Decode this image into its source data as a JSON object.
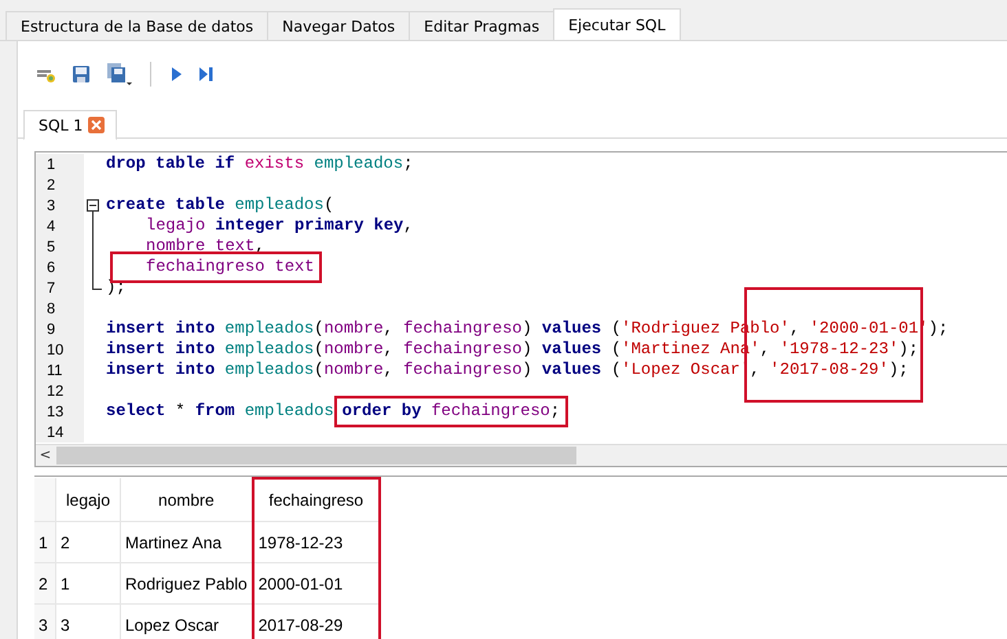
{
  "tabs": [
    {
      "label": "Estructura de la Base de datos",
      "selected": false
    },
    {
      "label": "Navegar Datos",
      "selected": false
    },
    {
      "label": "Editar Pragmas",
      "selected": false
    },
    {
      "label": "Ejecutar SQL",
      "selected": true
    }
  ],
  "editor_tab": {
    "label": "SQL 1"
  },
  "editor": {
    "values_box": true,
    "lines": [
      {
        "num": "1",
        "segments": [
          {
            "boxed": false,
            "tokens": [
              {
                "kind": "kw",
                "text": "drop table if "
              },
              {
                "kind": "fn",
                "text": "exists "
              },
              {
                "kind": "tbl",
                "text": "empleados"
              },
              {
                "kind": "p",
                "text": ";"
              }
            ]
          }
        ]
      },
      {
        "num": "2"
      },
      {
        "num": "3",
        "fold_start": true,
        "segments": [
          {
            "boxed": false,
            "tokens": [
              {
                "kind": "kw",
                "text": "create table "
              },
              {
                "kind": "tbl",
                "text": "empleados"
              },
              {
                "kind": "p",
                "text": "("
              }
            ]
          }
        ]
      },
      {
        "num": "4",
        "in_fold": true,
        "indented": true,
        "segments": [
          {
            "boxed": false,
            "tokens": [
              {
                "kind": "col",
                "text": "legajo "
              },
              {
                "kind": "kw",
                "text": "integer primary key"
              },
              {
                "kind": "p",
                "text": ","
              }
            ]
          }
        ]
      },
      {
        "num": "5",
        "in_fold": true,
        "indented": true,
        "segments": [
          {
            "boxed": false,
            "tokens": [
              {
                "kind": "col",
                "text": "nombre text"
              },
              {
                "kind": "p",
                "text": ","
              }
            ]
          }
        ]
      },
      {
        "num": "6",
        "in_fold": true,
        "indented": true,
        "segments": [
          {
            "boxed": true,
            "tokens": [
              {
                "kind": "col",
                "text": "fechaingreso text"
              }
            ]
          }
        ]
      },
      {
        "num": "7",
        "fold_end": true,
        "segments": [
          {
            "boxed": false,
            "tokens": [
              {
                "kind": "p",
                "text": ");"
              }
            ]
          }
        ]
      },
      {
        "num": "8"
      },
      {
        "num": "9",
        "segments": [
          {
            "boxed": false,
            "tokens": [
              {
                "kind": "kw",
                "text": "insert into "
              },
              {
                "kind": "tbl",
                "text": "empleados"
              },
              {
                "kind": "p",
                "text": "("
              },
              {
                "kind": "col",
                "text": "nombre"
              },
              {
                "kind": "p",
                "text": ", "
              },
              {
                "kind": "col",
                "text": "fechaingreso"
              },
              {
                "kind": "p",
                "text": ") "
              },
              {
                "kind": "kw",
                "text": "values "
              },
              {
                "kind": "p",
                "text": "("
              },
              {
                "kind": "str",
                "text": "'Rodriguez Pablo'"
              },
              {
                "kind": "p",
                "text": ", "
              },
              {
                "kind": "str",
                "text": "'2000-01-01'"
              },
              {
                "kind": "p",
                "text": ");"
              }
            ]
          }
        ]
      },
      {
        "num": "10",
        "segments": [
          {
            "boxed": false,
            "tokens": [
              {
                "kind": "kw",
                "text": "insert into "
              },
              {
                "kind": "tbl",
                "text": "empleados"
              },
              {
                "kind": "p",
                "text": "("
              },
              {
                "kind": "col",
                "text": "nombre"
              },
              {
                "kind": "p",
                "text": ", "
              },
              {
                "kind": "col",
                "text": "fechaingreso"
              },
              {
                "kind": "p",
                "text": ") "
              },
              {
                "kind": "kw",
                "text": "values "
              },
              {
                "kind": "p",
                "text": "("
              },
              {
                "kind": "str",
                "text": "'Martinez Ana'"
              },
              {
                "kind": "p",
                "text": ", "
              },
              {
                "kind": "str",
                "text": "'1978-12-23'"
              },
              {
                "kind": "p",
                "text": ");"
              }
            ]
          }
        ]
      },
      {
        "num": "11",
        "segments": [
          {
            "boxed": false,
            "tokens": [
              {
                "kind": "kw",
                "text": "insert into "
              },
              {
                "kind": "tbl",
                "text": "empleados"
              },
              {
                "kind": "p",
                "text": "("
              },
              {
                "kind": "col",
                "text": "nombre"
              },
              {
                "kind": "p",
                "text": ", "
              },
              {
                "kind": "col",
                "text": "fechaingreso"
              },
              {
                "kind": "p",
                "text": ") "
              },
              {
                "kind": "kw",
                "text": "values "
              },
              {
                "kind": "p",
                "text": "("
              },
              {
                "kind": "str",
                "text": "'Lopez Oscar'"
              },
              {
                "kind": "p",
                "text": ", "
              },
              {
                "kind": "str",
                "text": "'2017-08-29'"
              },
              {
                "kind": "p",
                "text": ");"
              }
            ]
          }
        ]
      },
      {
        "num": "12"
      },
      {
        "num": "13",
        "segments": [
          {
            "boxed": false,
            "tokens": [
              {
                "kind": "kw",
                "text": "select "
              },
              {
                "kind": "p",
                "text": "* "
              },
              {
                "kind": "kw",
                "text": "from "
              },
              {
                "kind": "tbl",
                "text": "empleados"
              }
            ]
          },
          {
            "boxed": true,
            "tokens": [
              {
                "kind": "kw",
                "text": "order by "
              },
              {
                "kind": "col",
                "text": "fechaingreso"
              },
              {
                "kind": "p",
                "text": ";"
              }
            ]
          }
        ]
      },
      {
        "num": "14"
      }
    ],
    "scroll_left": "<"
  },
  "results": {
    "columns": [
      {
        "label": "legajo",
        "marked": false
      },
      {
        "label": "nombre",
        "marked": false
      },
      {
        "label": "fechaingreso",
        "marked": true
      }
    ],
    "rows": [
      {
        "num": "1",
        "cells": [
          "2",
          "Martinez Ana",
          "1978-12-23"
        ]
      },
      {
        "num": "2",
        "cells": [
          "1",
          "Rodriguez Pablo",
          "2000-01-01"
        ]
      },
      {
        "num": "3",
        "cells": [
          "3",
          "Lopez Oscar",
          "2017-08-29"
        ]
      }
    ]
  }
}
